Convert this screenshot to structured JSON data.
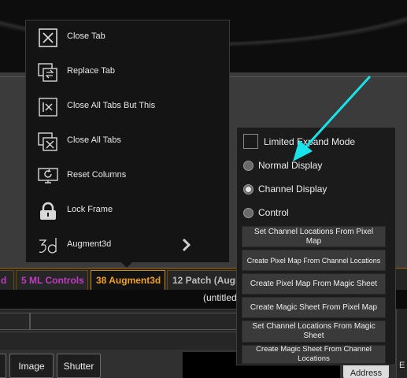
{
  "menu": {
    "items": [
      {
        "label": "Close Tab",
        "icon": "close-tab-icon"
      },
      {
        "label": "Replace Tab",
        "icon": "replace-tab-icon"
      },
      {
        "label": "Close All Tabs But This",
        "icon": "close-all-but-this-icon"
      },
      {
        "label": "Close All Tabs",
        "icon": "close-all-tabs-icon"
      },
      {
        "label": "Reset Columns",
        "icon": "reset-columns-icon"
      },
      {
        "label": "Lock Frame",
        "icon": "lock-icon"
      },
      {
        "label": "Augment3d",
        "icon": "augment3d-icon",
        "has_submenu": true
      }
    ]
  },
  "submenu": {
    "limited_expand_mode": {
      "label": "Limited Expand Mode",
      "checked": false
    },
    "display_options": [
      {
        "label": "Normal Display",
        "selected": false
      },
      {
        "label": "Channel Display",
        "selected": true
      },
      {
        "label": "Control",
        "selected": false
      }
    ],
    "buttons": [
      "Set Channel Locations From Pixel Map",
      "Create Pixel Map From Channel Locations",
      "Create Pixel Map From Magic Sheet",
      "Create Magic Sheet From Pixel Map",
      "Set Channel Locations From Magic Sheet",
      "Create Magic Sheet From Channel Locations"
    ]
  },
  "tabs": [
    {
      "label": "d"
    },
    {
      "label": "5 ML Controls"
    },
    {
      "label": "38 Augment3d",
      "active": true
    },
    {
      "label": "12 Patch (Augm"
    }
  ],
  "status": {
    "document_title": "(untitled)"
  },
  "bottom_buttons": {
    "image": "Image",
    "shutter": "Shutter",
    "address": "Address"
  },
  "colors": {
    "accent_tab": "#f0a020",
    "tab_label_magenta": "#c03cc0",
    "annotation_arrow": "#19e3ea"
  }
}
